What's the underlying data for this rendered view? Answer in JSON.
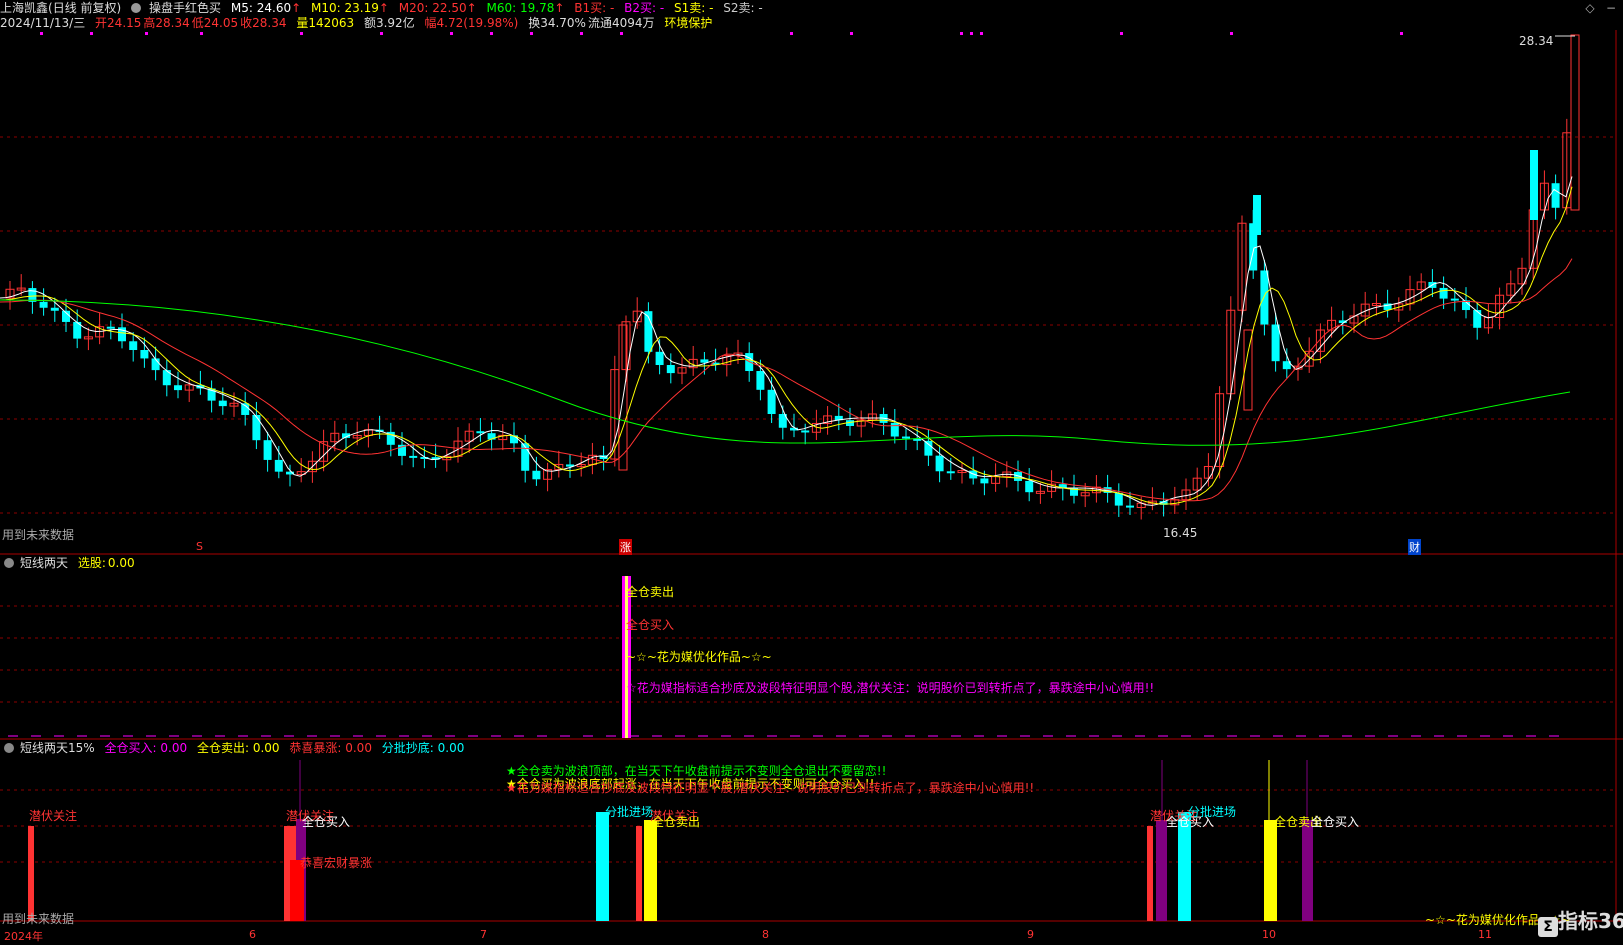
{
  "header": {
    "stock_name": "上海凯鑫",
    "mode": "(日线 前复权)",
    "indicator": "操盘手红色买",
    "ma": [
      {
        "label": "M5:",
        "value": "24.60",
        "arrow": "↑",
        "color": "#ffffff"
      },
      {
        "label": "M10:",
        "value": "23.19",
        "arrow": "↑",
        "color": "#ffff00"
      },
      {
        "label": "M20:",
        "value": "22.50",
        "arrow": "↑",
        "color": "#ff3333"
      },
      {
        "label": "M60:",
        "value": "19.78",
        "arrow": "↑",
        "color": "#00ff00"
      }
    ],
    "signals": [
      {
        "text": "B1买: -",
        "color": "#ff3333"
      },
      {
        "text": "B2买: -",
        "color": "#ff00ff"
      },
      {
        "text": "S1卖: -",
        "color": "#ffff00"
      },
      {
        "text": "S2卖: -",
        "color": "#cccccc"
      }
    ]
  },
  "quote": {
    "date": "2024/11/13/三",
    "open": "开24.15",
    "high": "高28.34",
    "low": "低24.05",
    "close": "收28.34",
    "volume": "量142063",
    "amount": "额3.92亿",
    "change": "幅4.72(19.98%)",
    "turnover": "换34.70%",
    "float": "流通4094万",
    "tag": "环境保护"
  },
  "price_chart": {
    "max_label": "28.34",
    "min_label": "16.45",
    "future_note": "用到未来数据",
    "event_markers": [
      {
        "text": "S",
        "color": "#ff3333"
      },
      {
        "text": "涨",
        "color": "#ffffff",
        "bg": "#cc0000"
      },
      {
        "text": "财",
        "color": "#ffffff",
        "bg": "#0044cc"
      }
    ]
  },
  "panel2": {
    "title": "短线两天",
    "select_label": "选股:",
    "select_value": "0.00",
    "annotations": [
      {
        "text": "全仓卖出",
        "color": "#ffff00"
      },
      {
        "text": "全仓买入",
        "color": "#ff3333"
      },
      {
        "text": "~☆~花为媒优化作品~☆~",
        "color": "#ffff00"
      },
      {
        "text": "☆花为媒指标适合抄底及波段特征明显个股,潜伏关注：说明股价已到转折点了，暴跌途中小心慎用!!",
        "color": "#ff00ff"
      }
    ]
  },
  "panel3": {
    "title": "短线两天15%",
    "legend": [
      {
        "label": "全仓买入:",
        "value": "0.00",
        "color": "#ff00ff"
      },
      {
        "label": "全仓卖出:",
        "value": "0.00",
        "color": "#ffff00"
      },
      {
        "label": "恭喜暴涨:",
        "value": "0.00",
        "color": "#ff3333"
      },
      {
        "label": "分批抄底:",
        "value": "0.00",
        "color": "#00ffff"
      }
    ],
    "notes": [
      {
        "text": "★全仓卖为波浪顶部，在当天下午收盘前提示不变则全仓退出不要留恋!!",
        "color": "#00ff00"
      },
      {
        "text": "★全仓买为波浪底部起涨，在当天下午收盘前提示不变则可全仓买入!!",
        "color": "#ffff00"
      },
      {
        "text": "★花为媒指标适合抄底及波段特征明显个股,潜伏关注：说明股价已到转折点了，暴跌途中小心慎用!!",
        "color": "#ff3333"
      }
    ],
    "labels": [
      {
        "text": "潜伏关注",
        "color": "#ff3333"
      },
      {
        "text": "潜伏关注",
        "color": "#ff3333"
      },
      {
        "text": "全仓买入",
        "color": "#ffffff"
      },
      {
        "text": "恭喜宏财暴涨",
        "color": "#ff3333"
      },
      {
        "text": "分批进场",
        "color": "#00ffff"
      },
      {
        "text": "潜伏关注",
        "color": "#ff3333"
      },
      {
        "text": "全仓卖出",
        "color": "#ffff00"
      },
      {
        "text": "潜伏关注",
        "color": "#ff3333"
      },
      {
        "text": "全仓买入",
        "color": "#ffffff"
      },
      {
        "text": "分批进场",
        "color": "#00ffff"
      },
      {
        "text": "全仓卖出",
        "color": "#ffff00"
      },
      {
        "text": "全仓买入",
        "color": "#ffffff"
      }
    ],
    "future_note": "用到未来数据",
    "footer_credit": "~☆~花为媒优化作品~☆~"
  },
  "time_axis": [
    "2024年",
    "6",
    "7",
    "8",
    "9",
    "10",
    "11"
  ],
  "watermark": "指标365",
  "icons": {
    "diamond": "diamond-icon",
    "minimize": "minimize-icon",
    "close": "close-icon"
  },
  "colors": {
    "background": "#000000",
    "up_candle": "#ff3333",
    "down_candle": "#00ffff",
    "ma5": "#ffffff",
    "ma10": "#ffff00",
    "ma20": "#ff3333",
    "ma60": "#00ff00",
    "grid": "#8b0000"
  }
}
